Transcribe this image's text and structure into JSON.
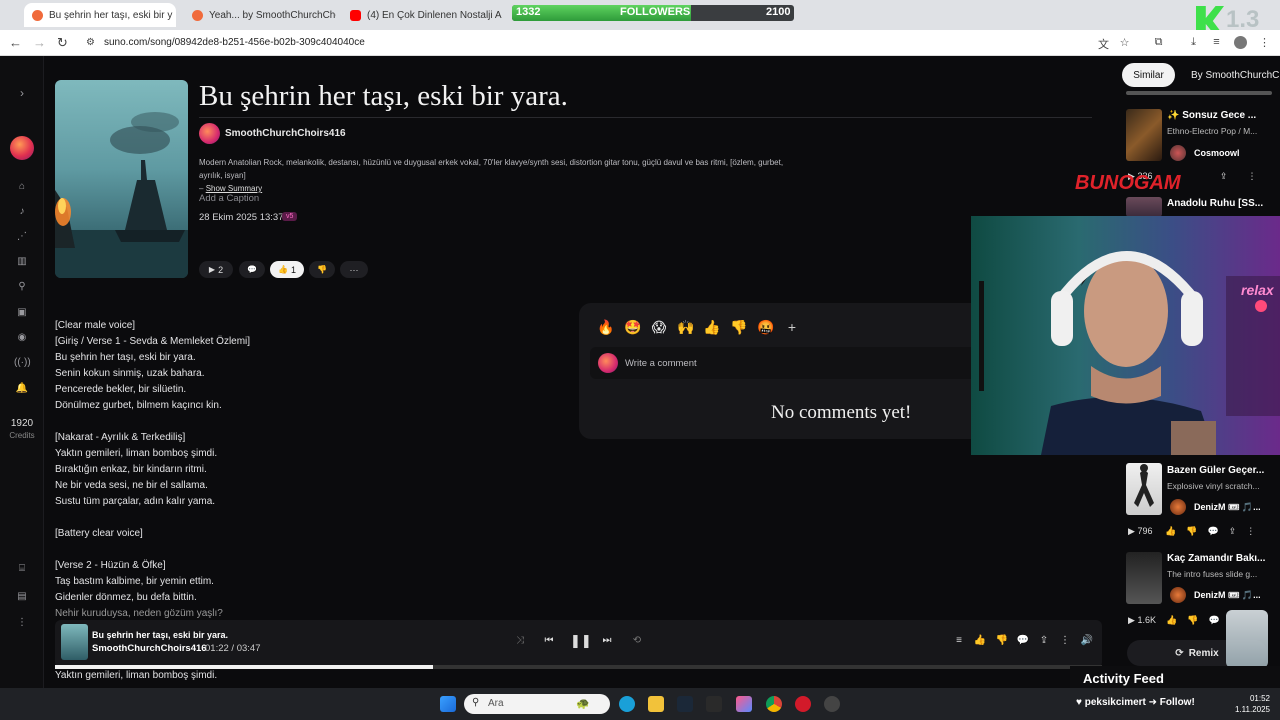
{
  "browser": {
    "tabs": [
      {
        "label": "Bu şehrin her taşı, eski bir y",
        "active": true,
        "favicon_color": "#f06a3b"
      },
      {
        "label": "Yeah... by SmoothChurchChoirs",
        "active": false,
        "favicon_color": "#f06a3b"
      },
      {
        "label": "(4) En Çok Dinlenen Nostalji Ar",
        "active": false,
        "favicon_color": "#ff0000"
      }
    ],
    "url": "suno.com/song/08942de8-b251-456e-b02b-309c404040ce"
  },
  "overlay": {
    "followers_current": "1332",
    "followers_label": "FOLLOWERS",
    "followers_goal": "2100",
    "followers_fraction": 0.634,
    "brand_mark": "BUNOGAM",
    "webcam_neon": "relax"
  },
  "sidebar": {
    "credits_value": "1920",
    "credits_label": "Credits",
    "icons": [
      "home-icon",
      "music-icon",
      "share-icon",
      "library-icon",
      "search-icon",
      "box-icon",
      "compass-icon",
      "radio-icon",
      "bell-icon",
      "gift-icon",
      "doc-icon",
      "more-icon"
    ]
  },
  "song": {
    "title": "Bu şehrin her taşı, eski bir yara.",
    "artist": "SmoothChurchChoirs416",
    "styles": "Modern Anatolian Rock, melankolik, destansı, hüzünlü ve duygusal erkek vokal, 70'ler klavye/synth sesi, distortion gitar tonu, güçlü davul ve bas ritmi, [özlem, gurbet, ayrılık, isyan]",
    "show_summary_prefix": "–",
    "show_summary": "Show Summary",
    "add_caption": "Add a Caption",
    "date": "28 Ekim 2025 13:37",
    "version_badge": "v5",
    "plays": "2",
    "likes": "1"
  },
  "lyrics": [
    "[Clear male voice]",
    "[Giriş / Verse 1 - Sevda & Memleket Özlemi]",
    "Bu şehrin her taşı, eski bir yara.",
    "Senin kokun sinmiş, uzak bahara.",
    "Pencerede bekler, bir silüetin.",
    "Dönülmez gurbet, bilmem kaçıncı kin.",
    "",
    "[Nakarat - Ayrılık & Terkediliş]",
    "Yaktın gemileri, liman bomboş şimdi.",
    "Bıraktığın enkaz, bir kindarın ritmi.",
    "Ne bir veda sesi, ne bir el sallama.",
    "Sustu tüm parçalar, adın kalır yama.",
    "",
    "[Battery clear voice]",
    "",
    "[Verse 2 - Hüzün & Öfke]",
    "Taş bastım kalbime, bir yemin ettim.",
    "Gidenler dönmez, bu defa bittin.",
    "Nehir kuruduysa, neden gözüm yaşlı?"
  ],
  "lyrics_below_player": "Yaktın gemileri, liman bomboş şimdi.",
  "comments": {
    "reactions": [
      "🔥",
      "🤩",
      "😱",
      "🙌",
      "👍",
      "👎",
      "🤬"
    ],
    "add_reaction": "+",
    "placeholder": "Write a comment",
    "empty_text": "No comments yet!"
  },
  "right": {
    "tabs": [
      "Similar",
      "By SmoothChurchChoirs416"
    ],
    "items": [
      {
        "title": "✨ Sonsuz Gece ...",
        "subtitle": "Ethno-Electro Pop / M...",
        "artist": "Cosmoowl",
        "plays": "336"
      },
      {
        "title": "Anadolu Ruhu [SS...",
        "subtitle": "",
        "artist": "",
        "plays": ""
      },
      {
        "title": "Bazen Güler Geçer...",
        "subtitle": "Explosive vinyl scratch...",
        "artist": "DenizM 🎟 🎵...",
        "plays": "796"
      },
      {
        "title": "Kaç Zamandır Bakı...",
        "subtitle": "The intro fuses slide g...",
        "artist": "DenizM 🎟 🎵...",
        "plays": "1.6K"
      }
    ],
    "remix": "Remix"
  },
  "player": {
    "title": "Bu şehrin her taşı, eski bir yara.",
    "artist": "SmoothChurchChoirs416",
    "current": "01:22",
    "sep": "/",
    "duration": "03:47",
    "progress": 0.361
  },
  "stream": {
    "activity_feed": "Activity Feed",
    "follower_event": "peksikcimert ➜ Follow!"
  },
  "taskbar": {
    "search_placeholder": "Ara",
    "time": "01:52",
    "date": "1.11.2025"
  }
}
